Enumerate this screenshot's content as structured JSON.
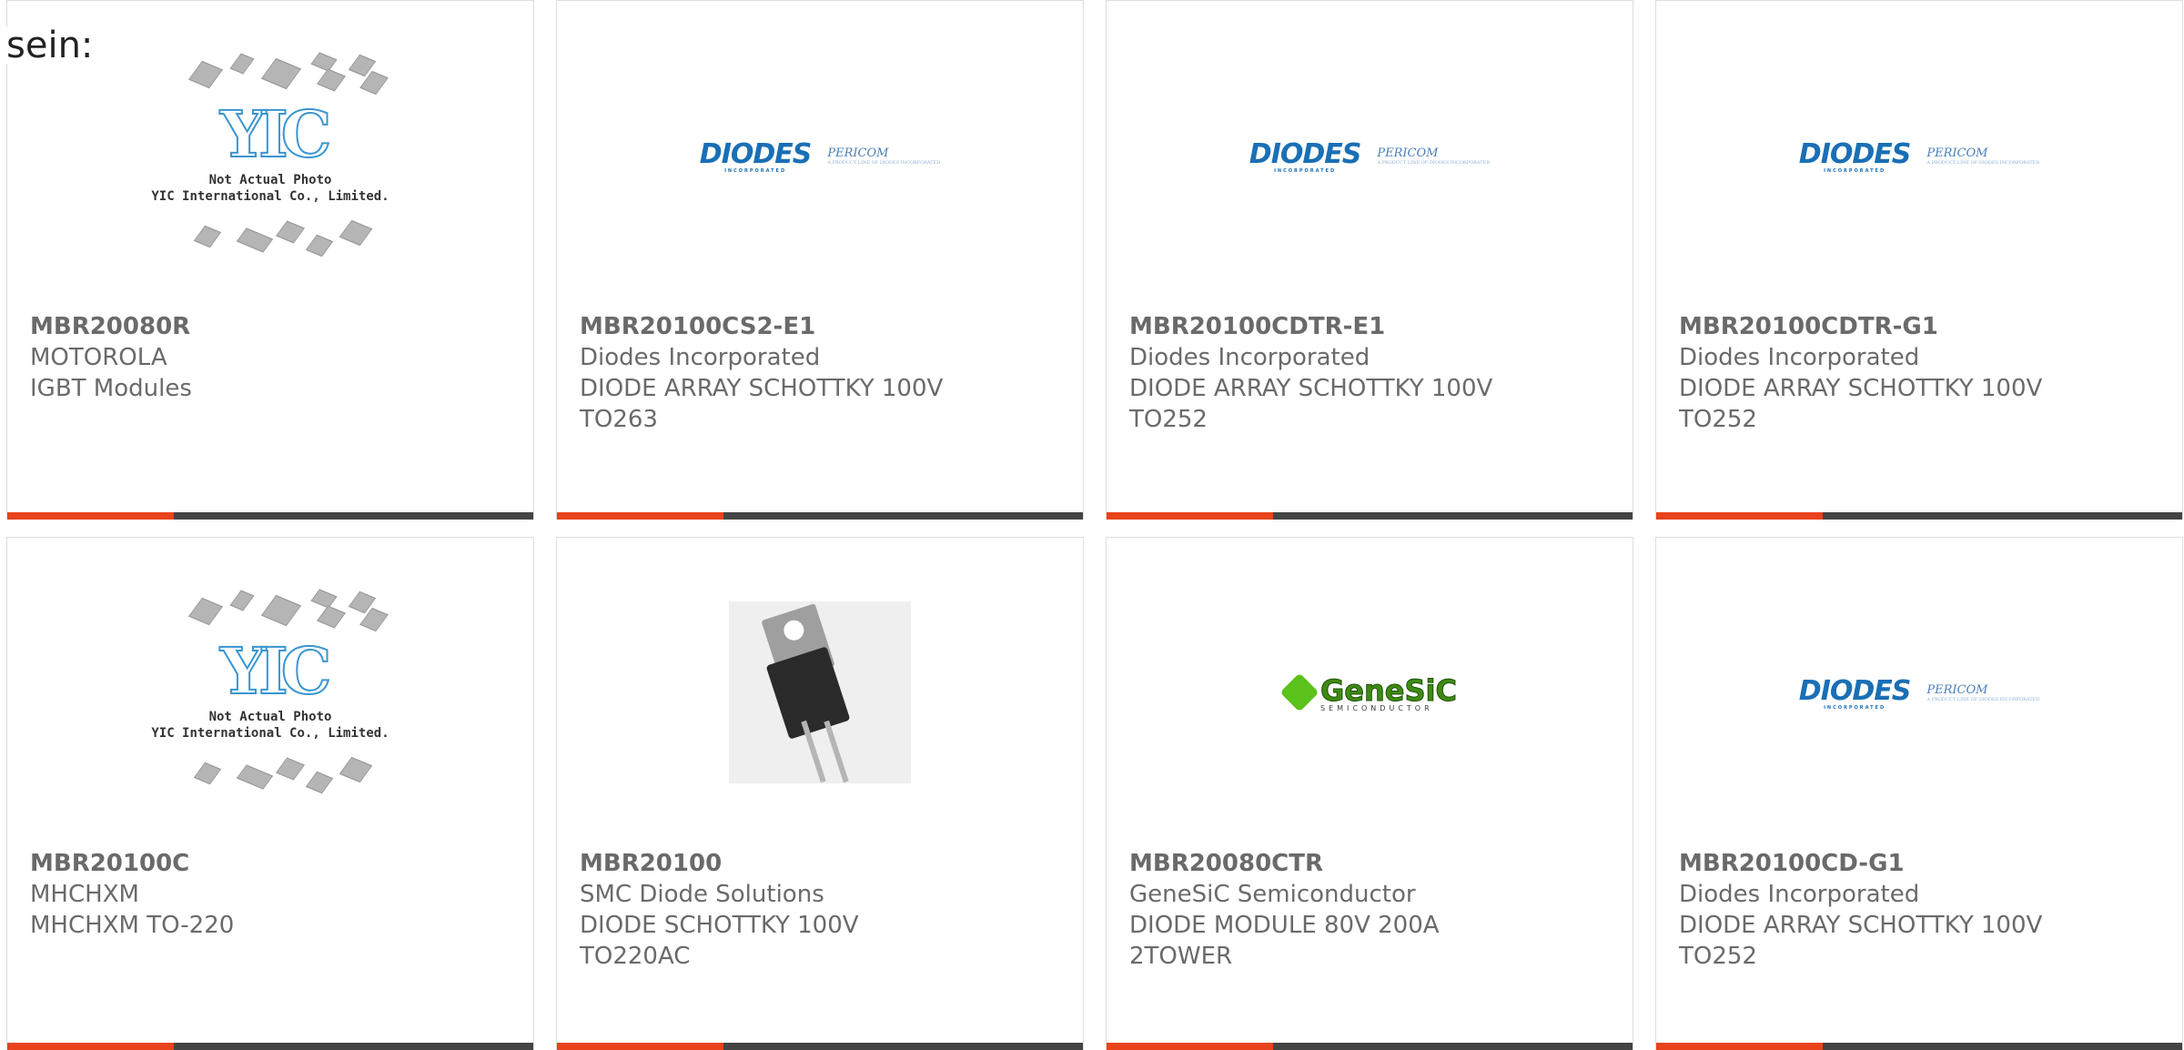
{
  "intro_text": "sein:",
  "products": [
    {
      "part": "MBR20080R",
      "maker": "MOTOROLA",
      "desc1": "IGBT Modules",
      "desc2": "",
      "image": "yic-placeholder"
    },
    {
      "part": "MBR20100CS2-E1",
      "maker": "Diodes Incorporated",
      "desc1": "DIODE ARRAY SCHOTTKY 100V",
      "desc2": "TO263",
      "image": "diodes-logo"
    },
    {
      "part": "MBR20100CDTR-E1",
      "maker": "Diodes Incorporated",
      "desc1": "DIODE ARRAY SCHOTTKY 100V",
      "desc2": "TO252",
      "image": "diodes-logo"
    },
    {
      "part": "MBR20100CDTR-G1",
      "maker": "Diodes Incorporated",
      "desc1": "DIODE ARRAY SCHOTTKY 100V",
      "desc2": "TO252",
      "image": "diodes-logo"
    },
    {
      "part": "MBR20100C",
      "maker": "MHCHXM",
      "desc1": "MHCHXM TO-220",
      "desc2": "",
      "image": "yic-placeholder"
    },
    {
      "part": "MBR20100",
      "maker": "SMC Diode Solutions",
      "desc1": "DIODE SCHOTTKY 100V",
      "desc2": "TO220AC",
      "image": "to220-photo"
    },
    {
      "part": "MBR20080CTR",
      "maker": "GeneSiC Semiconductor",
      "desc1": "DIODE MODULE 80V 200A",
      "desc2": "2TOWER",
      "image": "genesic-logo"
    },
    {
      "part": "MBR20100CD-G1",
      "maker": "Diodes Incorporated",
      "desc1": "DIODE ARRAY SCHOTTKY 100V",
      "desc2": "TO252",
      "image": "diodes-logo"
    }
  ],
  "logos": {
    "diodes": "DIODES",
    "diodes_sub": "INCORPORATED",
    "pericom": "PERICOM",
    "pericom_sub": "A PRODUCT LINE OF DIODES INCORPORATED",
    "genesic": "GeneSiC",
    "genesic_sub": "SEMICONDUCTOR",
    "yic_mark": "YIC",
    "yic_caption_1": "Not Actual Photo",
    "yic_caption_2": "YIC International Co., Limited."
  },
  "colors": {
    "accent_bar": "#e8431a",
    "bar": "#444444",
    "diodes_blue": "#1a6fb5",
    "genesic_green": "#5ac21a"
  }
}
